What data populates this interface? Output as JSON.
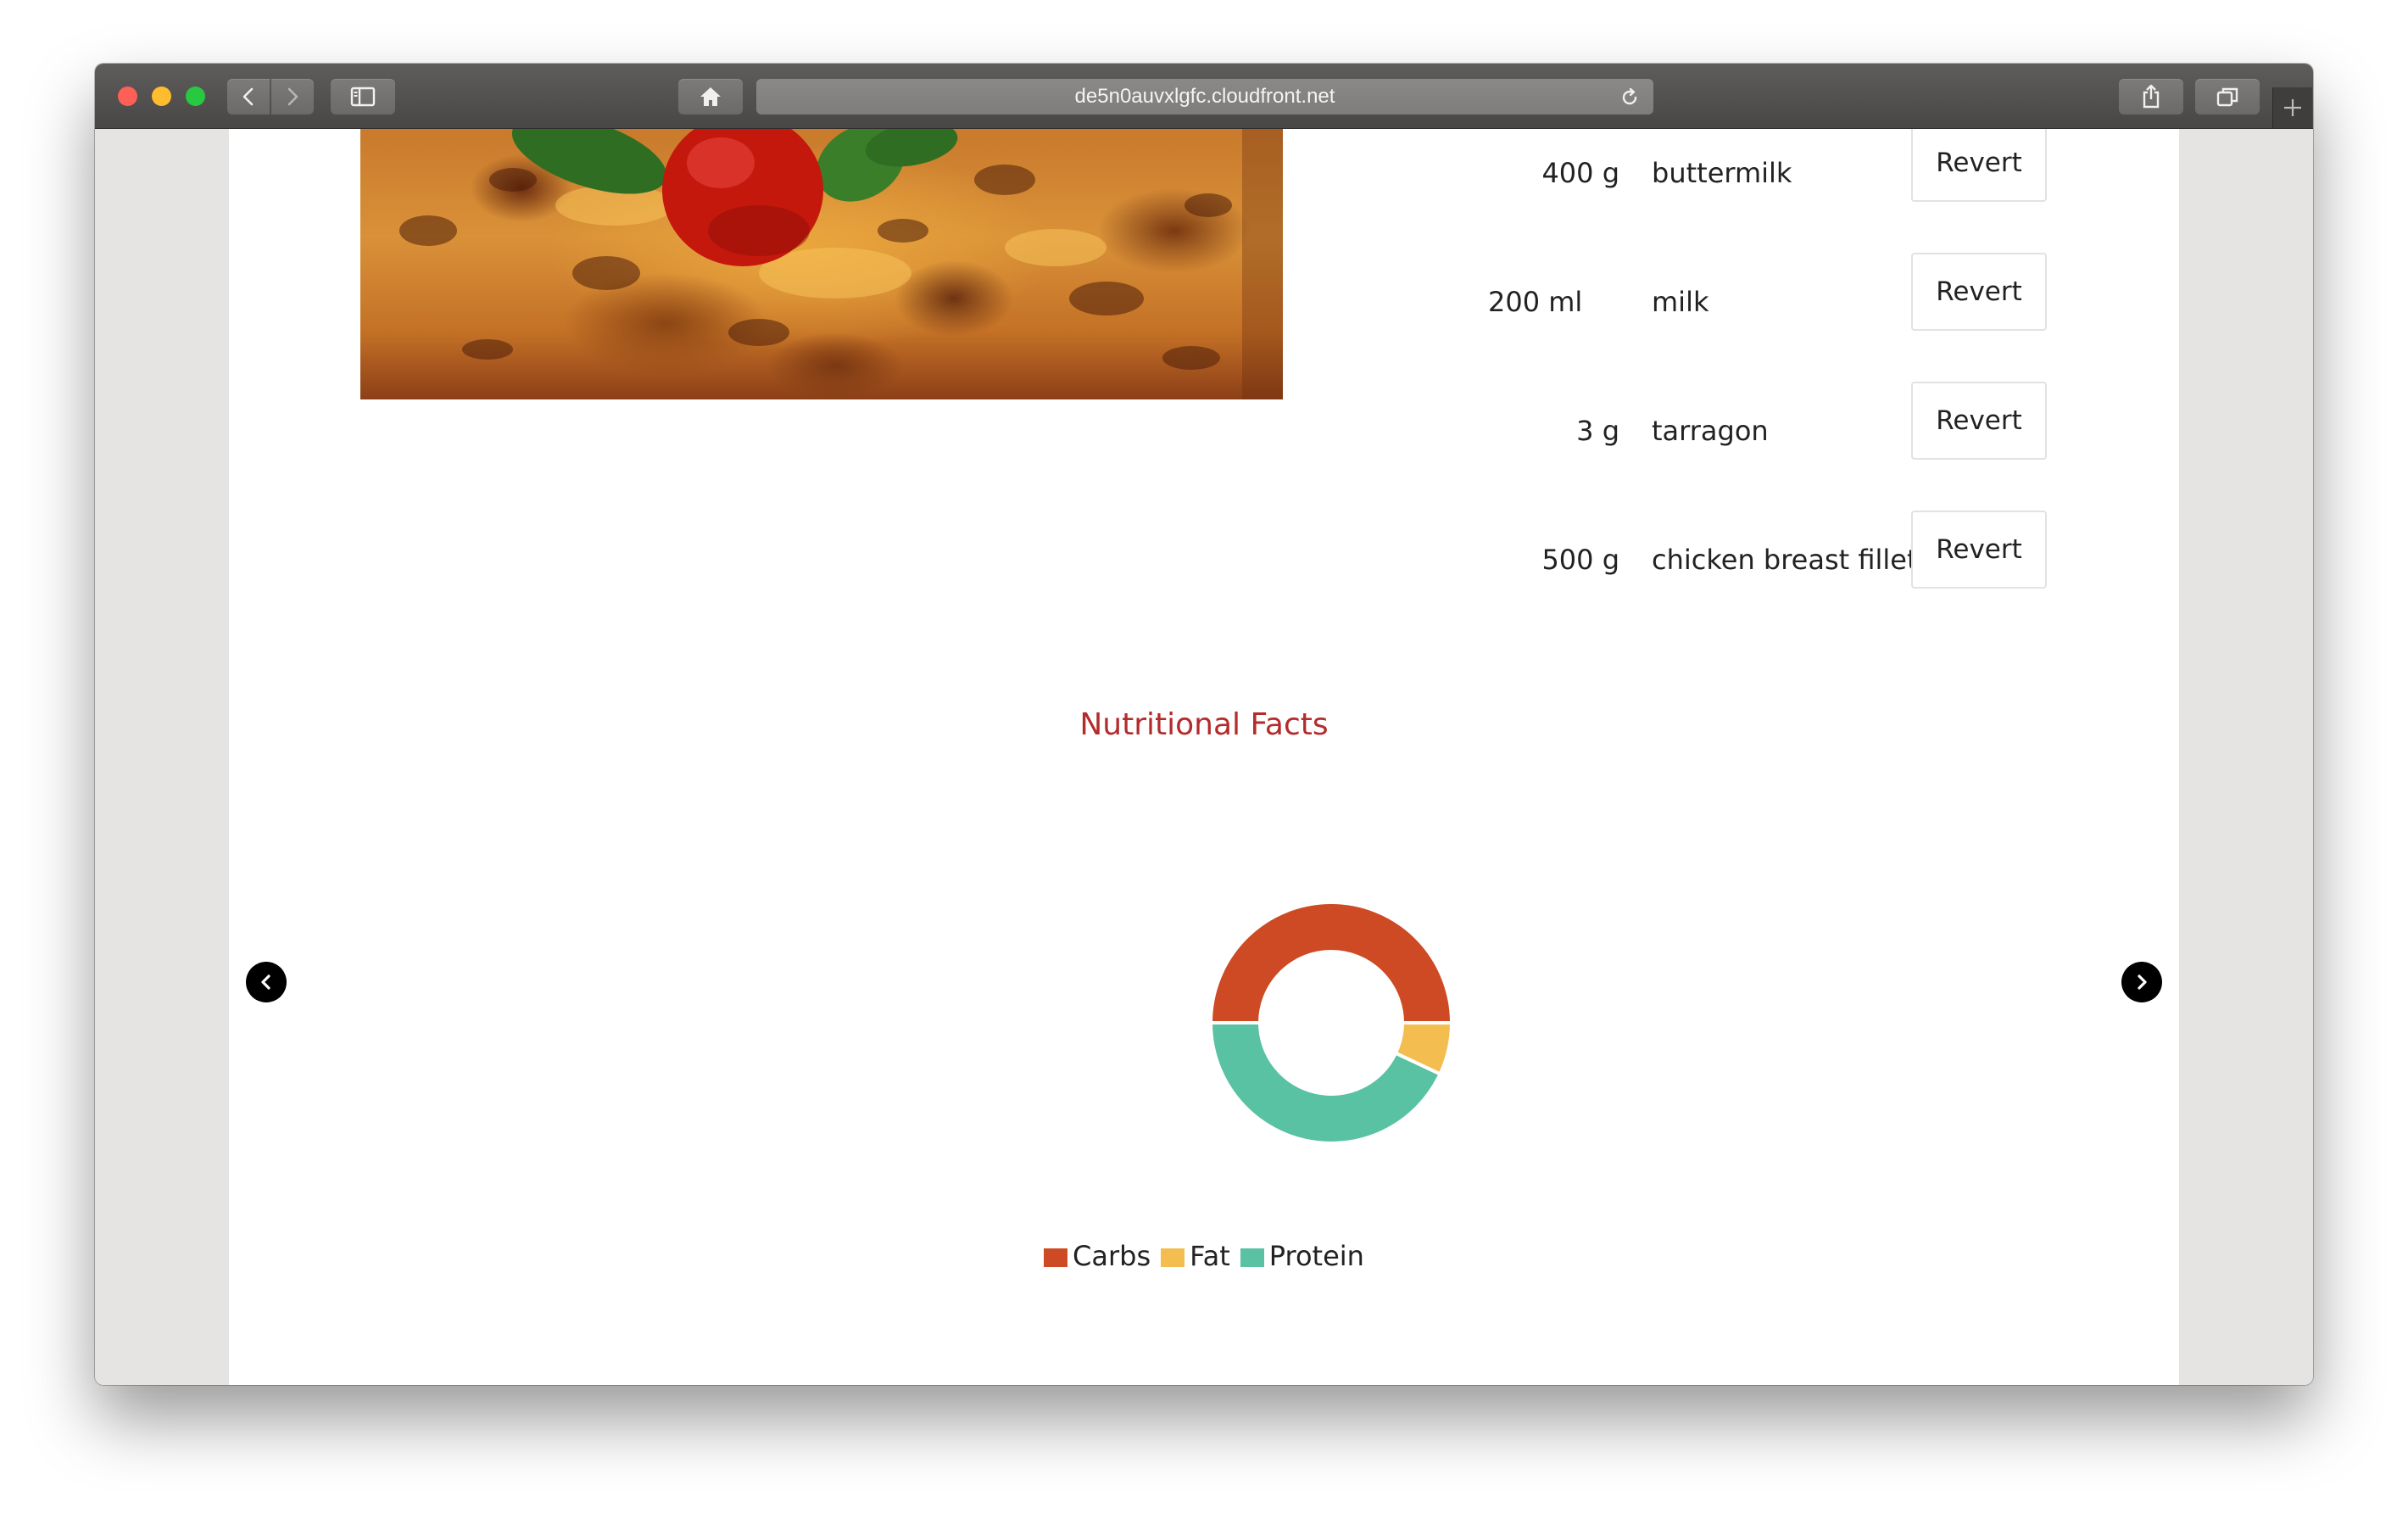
{
  "browser": {
    "url": "de5n0auvxlgfc.cloudfront.net"
  },
  "ingredients": [
    {
      "qty": "400 g",
      "name": "buttermilk",
      "revert": "Revert"
    },
    {
      "qty": "200 ml",
      "name": "milk",
      "revert": "Revert"
    },
    {
      "qty": "3 g",
      "name": "tarragon",
      "revert": "Revert"
    },
    {
      "qty": "500 g",
      "name": "chicken breast fillet",
      "revert": "Revert"
    }
  ],
  "nutrition": {
    "title": "Nutritional Facts"
  },
  "chart_data": {
    "type": "pie",
    "categories": [
      "Carbs",
      "Fat",
      "Protein"
    ],
    "values": [
      50,
      7,
      43
    ],
    "colors": [
      "#cd4a24",
      "#f4bd4f",
      "#58c2a2"
    ],
    "legend": "bottom",
    "donut": true
  },
  "colors": {
    "accent_title": "#b42b2b"
  }
}
